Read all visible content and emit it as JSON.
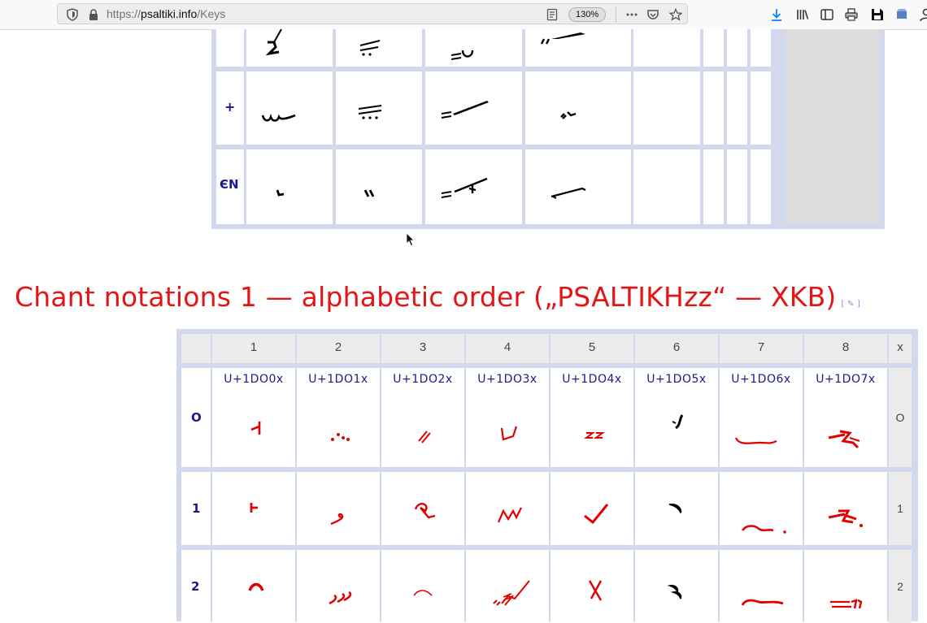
{
  "browser": {
    "url_scheme": "https://",
    "url_host": "psaltiki.info",
    "url_path": "/Keys",
    "zoom": "130%"
  },
  "upper_table": {
    "row_labels": [
      "+",
      "ЄN"
    ]
  },
  "heading": {
    "text": "Chant notations 1  — alphabetic order („PSALTIKHzz“ — XKB)",
    "edit_link": "[ ✎ ]"
  },
  "lower_table": {
    "columns": [
      "1",
      "2",
      "3",
      "4",
      "5",
      "6",
      "7",
      "8"
    ],
    "right_header": "x",
    "codes": [
      "U+1DO0x",
      "U+1DO1x",
      "U+1DO2x",
      "U+1DO3x",
      "U+1DO4x",
      "U+1DO5x",
      "U+1DO6x",
      "U+1DO7x"
    ],
    "rows": [
      {
        "label": "O",
        "right": "O"
      },
      {
        "label": "1",
        "right": "1"
      },
      {
        "label": "2",
        "right": "2"
      }
    ]
  },
  "colors": {
    "heading": "#e31515",
    "glyph_red": "#e00000",
    "glyph_black": "#000000",
    "table_border": "#d4d8ef",
    "label_blue": "#1a1a8c"
  }
}
